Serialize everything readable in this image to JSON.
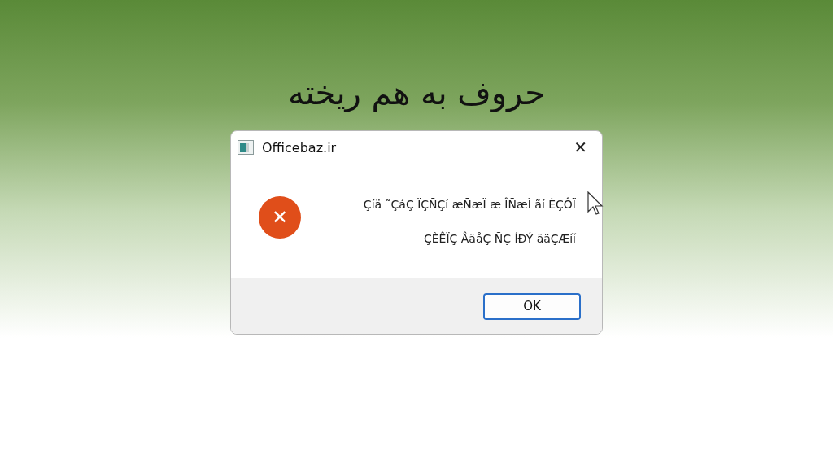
{
  "heading": "حروف به هم ریخته",
  "dialog": {
    "title": "Officebaz.ir",
    "close": "✕",
    "message_lines": [
      "Çíä ˜ÇáÇ ÏÇÑÇí æÑæÏ æ ÎÑæÌ ãí ÈÇÔÏ",
      "ÇÈÊÏÇ ÂäåÇ ÑÇ ÍÐÝ äãÇÆíí"
    ],
    "icon": {
      "kind": "error",
      "symbol": "✕"
    },
    "buttons": [
      {
        "label": "OK",
        "selected": true
      }
    ]
  }
}
